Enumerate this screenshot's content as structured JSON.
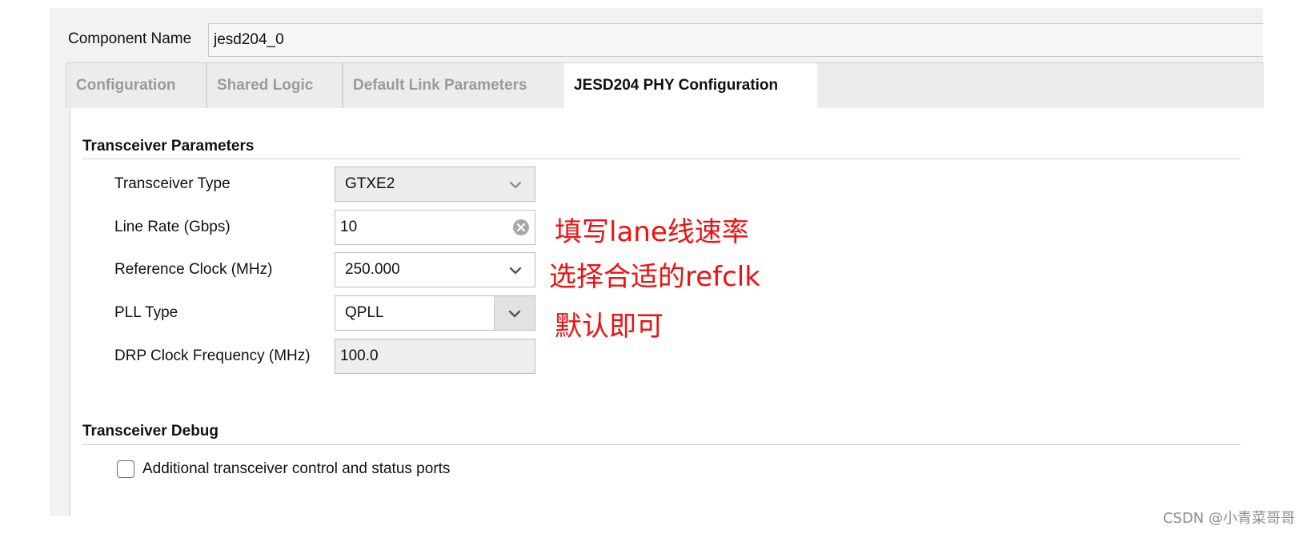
{
  "component": {
    "label": "Component Name",
    "value": "jesd204_0"
  },
  "tabs": [
    {
      "label": "Configuration",
      "active": false
    },
    {
      "label": "Shared Logic",
      "active": false
    },
    {
      "label": "Default Link Parameters",
      "active": false
    },
    {
      "label": "JESD204 PHY Configuration",
      "active": true
    }
  ],
  "transceiver_parameters": {
    "title": "Transceiver Parameters",
    "rows": [
      {
        "label": "Transceiver Type",
        "value": "GTXE2",
        "control": "dropdown"
      },
      {
        "label": "Line Rate (Gbps)",
        "value": "10",
        "control": "text",
        "icon": "clear-icon"
      },
      {
        "label": "Reference Clock (MHz)",
        "value": "250.000",
        "control": "dropdown"
      },
      {
        "label": "PLL Type",
        "value": "QPLL",
        "control": "dropdown-button"
      },
      {
        "label": "DRP Clock Frequency (MHz)",
        "value": "100.0",
        "control": "readonly"
      }
    ]
  },
  "annotations": [
    "填写lane线速率",
    "选择合适的refclk",
    "默认即可"
  ],
  "transceiver_debug": {
    "title": "Transceiver Debug",
    "checkbox_label": "Additional transceiver control and status ports",
    "checked": false
  },
  "watermark": "CSDN @小青菜哥哥",
  "colors": {
    "annotation": "#ee1111",
    "panel_bg": "#f2f2f2",
    "active_tab_bg": "#ffffff",
    "inactive_tab_text": "#9a9a9a"
  }
}
